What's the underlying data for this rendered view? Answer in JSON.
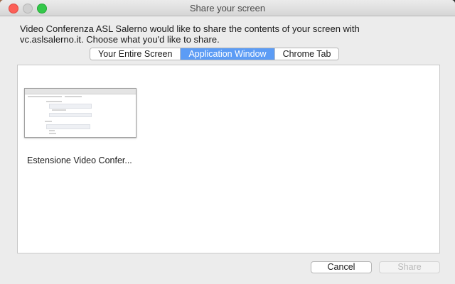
{
  "dialog": {
    "title": "Share your screen",
    "message_line1": "Video Conferenza ASL Salerno would like to share the contents of your screen with",
    "message_line2": "vc.aslsalerno.it. Choose what you'd like to share."
  },
  "tabs": [
    {
      "label": "Your Entire Screen",
      "active": false
    },
    {
      "label": "Application Window",
      "active": true
    },
    {
      "label": "Chrome Tab",
      "active": false
    }
  ],
  "windows": [
    {
      "label": "Estensione Video Confer...",
      "icon": "window-thumbnail"
    }
  ],
  "buttons": {
    "cancel": "Cancel",
    "share": "Share",
    "share_enabled": false
  },
  "colors": {
    "accent": "#5c9cf5",
    "close": "#fc5f57",
    "maximize": "#34c84a"
  }
}
